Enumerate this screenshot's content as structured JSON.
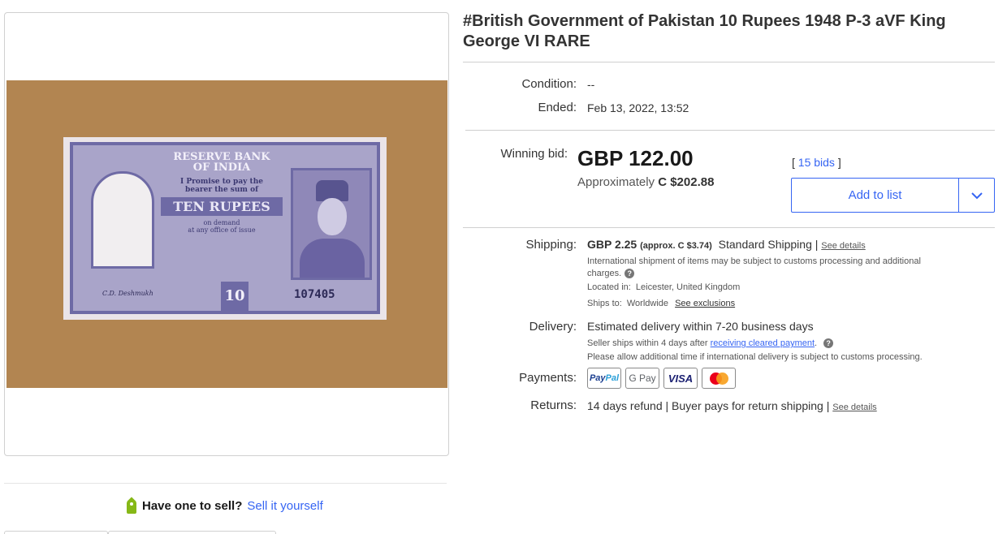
{
  "listing": {
    "title": "#British Government of Pakistan 10 Rupees 1948 P-3 aVF King George VI RARE",
    "condition_label": "Condition:",
    "condition_value": "--",
    "ended_label": "Ended:",
    "ended_value": "Feb 13, 2022, 13:52"
  },
  "bid": {
    "label": "Winning bid:",
    "price": "GBP 122.00",
    "approx_prefix": "Approximately",
    "approx_value": "C $202.88",
    "bids_open": "[",
    "bids_link": "15 bids",
    "bids_close": "]",
    "add_to_list": "Add to list"
  },
  "shipping": {
    "label": "Shipping:",
    "cost": "GBP 2.25",
    "approx": "(approx. C $3.74)",
    "method": "Standard Shipping",
    "sep": "|",
    "see_details": "See details",
    "intl_note_line1": "International shipment of items may be subject to customs processing and additional",
    "intl_note_line2": "charges.",
    "located_label": "Located in:",
    "located_value": "Leicester, United Kingdom",
    "ships_label": "Ships to:",
    "ships_value": "Worldwide",
    "see_exclusions": "See exclusions"
  },
  "delivery": {
    "label": "Delivery:",
    "main": "Estimated delivery within 7-20 business days",
    "note1_prefix": "Seller ships within 4 days after",
    "note1_link": "receiving cleared payment",
    "note1_suffix": ".",
    "note2": "Please allow additional time if international delivery is subject to customs processing."
  },
  "payments": {
    "label": "Payments:",
    "methods": [
      "PayPal",
      "G Pay",
      "VISA",
      "Mastercard"
    ],
    "paypal_a": "Pay",
    "paypal_b": "Pal",
    "gpay": "G Pay",
    "visa": "VISA"
  },
  "returns": {
    "label": "Returns:",
    "text": "14 days refund | Buyer pays for return shipping",
    "sep": "|",
    "see_details": "See details"
  },
  "sell": {
    "question": "Have one to sell?",
    "link": "Sell it yourself"
  },
  "banknote": {
    "bank_name_1": "RESERVE BANK",
    "bank_name_2": "OF INDIA",
    "promise_1": "I Promise to pay the",
    "promise_2": "bearer the sum of",
    "denomination": "TEN RUPEES",
    "on_demand_1": "on demand",
    "on_demand_2": "at any office of issue",
    "ten": "10",
    "serial": "107405",
    "signature": "C.D. Deshmukh"
  },
  "help_glyph": "?",
  "icons": {
    "chevron": "chevron-down-icon",
    "tag": "price-tag-icon",
    "help": "help-icon"
  },
  "colors": {
    "link_blue": "#3665f3",
    "tag_green": "#86b817",
    "banknote_background": "#b28551"
  }
}
